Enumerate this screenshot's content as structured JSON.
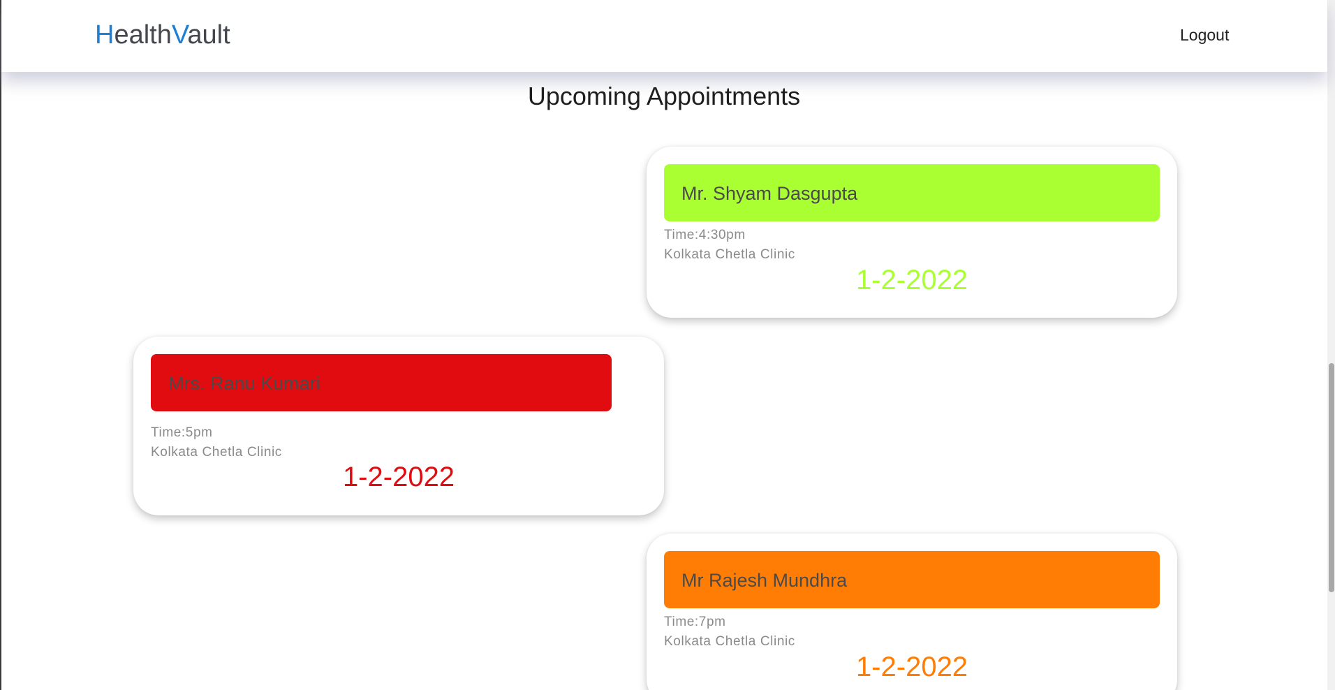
{
  "navbar": {
    "brand": [
      {
        "text": "H",
        "accent": true
      },
      {
        "text": "ealth",
        "accent": false
      },
      {
        "text": "V",
        "accent": true
      },
      {
        "text": "ault",
        "accent": false
      }
    ],
    "logout_label": "Logout"
  },
  "page_title": "Upcoming Appointments",
  "appointments": [
    {
      "name": "Mr. Shyam Dasgupta",
      "time": "Time:4:30pm",
      "location": "Kolkata Chetla Clinic",
      "date": "1-2-2022",
      "color": "#aaff33"
    },
    {
      "name": "Mrs. Ranu Kumari",
      "time": "Time:5pm",
      "location": "Kolkata Chetla Clinic",
      "date": "1-2-2022",
      "color": "#e10c0f"
    },
    {
      "name": "Mr Rajesh Mundhra",
      "time": "Time:7pm",
      "location": "Kolkata Chetla Clinic",
      "date": "1-2-2022",
      "color": "#ff7d05"
    }
  ],
  "colors": {
    "brand_accent": "#1f7fd3",
    "brand_text": "#44474d"
  }
}
